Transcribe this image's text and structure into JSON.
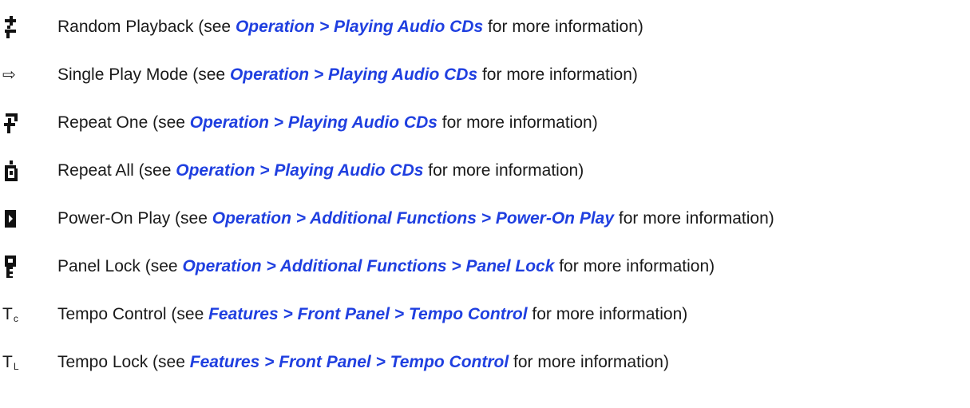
{
  "rows": [
    {
      "icon": "random-playback-icon",
      "label_before": "Random Playback (see ",
      "link": "Operation > Playing Audio CDs",
      "label_after": " for more information)"
    },
    {
      "icon": "single-play-arrow-icon",
      "label_before": "Single Play Mode (see ",
      "link": "Operation > Playing Audio CDs",
      "label_after": " for more information)"
    },
    {
      "icon": "repeat-one-icon",
      "label_before": "Repeat One (see ",
      "link": "Operation > Playing Audio CDs",
      "label_after": " for more information)"
    },
    {
      "icon": "repeat-all-icon",
      "label_before": "Repeat All (see ",
      "link": "Operation > Playing Audio CDs",
      "label_after": " for more information)"
    },
    {
      "icon": "power-on-play-icon",
      "label_before": "Power-On Play (see ",
      "link": "Operation > Additional Functions > Power-On Play",
      "label_after": " for more information)"
    },
    {
      "icon": "panel-lock-icon",
      "label_before": "Panel Lock (see ",
      "link": "Operation > Additional Functions > Panel Lock",
      "label_after": " for more information)"
    },
    {
      "icon": "tempo-control-icon",
      "glyph_main": "T",
      "glyph_sub": "c",
      "label_before": "Tempo Control (see ",
      "link": "Features > Front Panel > Tempo Control",
      "label_after": " for more information)"
    },
    {
      "icon": "tempo-lock-icon",
      "glyph_main": "T",
      "glyph_sub": "L",
      "label_before": "Tempo Lock (see ",
      "link": "Features > Front Panel > Tempo Control",
      "label_after": " for more information)"
    }
  ],
  "arrow_glyph": "⇨"
}
